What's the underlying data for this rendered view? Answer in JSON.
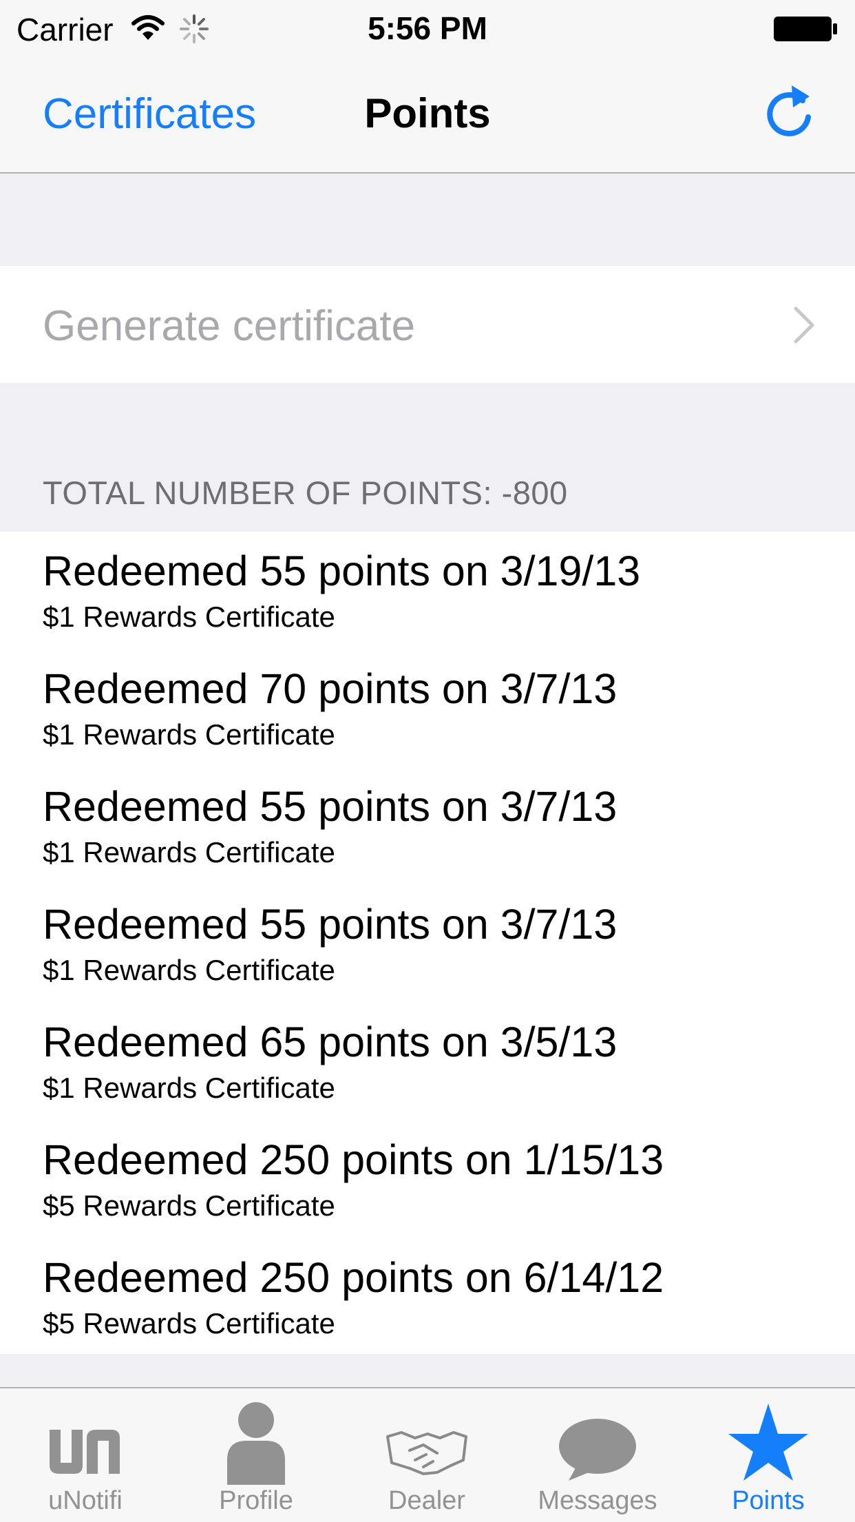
{
  "status_bar": {
    "carrier": "Carrier",
    "time": "5:56 PM"
  },
  "nav_bar": {
    "back_label": "Certificates",
    "title": "Points",
    "refresh_icon": "refresh-icon"
  },
  "generate": {
    "label": "Generate certificate"
  },
  "section": {
    "header": "TOTAL NUMBER OF POINTS: -800"
  },
  "history": [
    {
      "title": "Redeemed 55 points on 3/19/13",
      "subtitle": "$1 Rewards Certificate"
    },
    {
      "title": "Redeemed 70 points on 3/7/13",
      "subtitle": "$1 Rewards Certificate"
    },
    {
      "title": "Redeemed 55 points on 3/7/13",
      "subtitle": "$1 Rewards Certificate"
    },
    {
      "title": "Redeemed 55 points on 3/7/13",
      "subtitle": "$1 Rewards Certificate"
    },
    {
      "title": "Redeemed 65 points on 3/5/13",
      "subtitle": "$1 Rewards Certificate"
    },
    {
      "title": "Redeemed 250 points on 1/15/13",
      "subtitle": "$5 Rewards Certificate"
    },
    {
      "title": "Redeemed 250 points on 6/14/12",
      "subtitle": "$5 Rewards Certificate"
    }
  ],
  "tabs": [
    {
      "label": "uNotifi",
      "icon": "unotifi-logo-icon"
    },
    {
      "label": "Profile",
      "icon": "person-icon"
    },
    {
      "label": "Dealer",
      "icon": "handshake-icon"
    },
    {
      "label": "Messages",
      "icon": "speech-bubble-icon"
    },
    {
      "label": "Points",
      "icon": "star-icon",
      "active": true
    }
  ],
  "colors": {
    "tint": "#157efb",
    "inactive": "#929292",
    "background": "#efeff4"
  }
}
